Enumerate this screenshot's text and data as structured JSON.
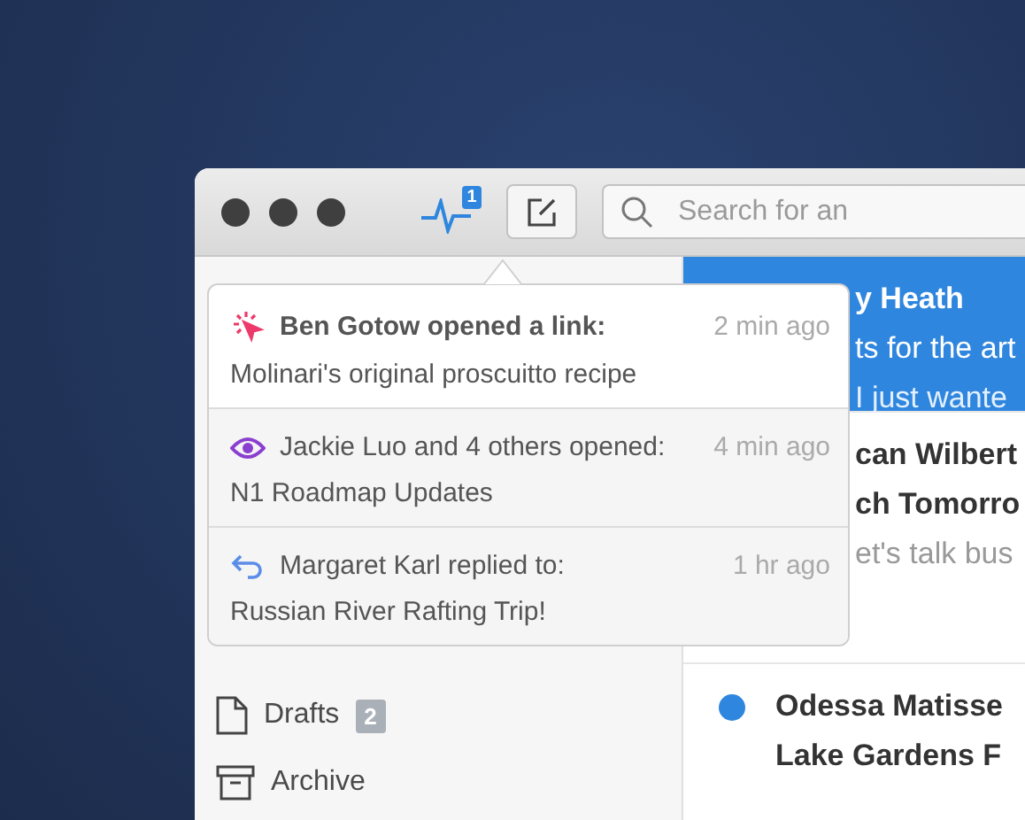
{
  "toolbar": {
    "activity_badge": "1",
    "search": {
      "placeholder": "Search for an"
    }
  },
  "sidebar": {
    "items": [
      {
        "label": "Drafts",
        "count": "2"
      },
      {
        "label": "Archive"
      }
    ]
  },
  "messages": [
    {
      "from": "y Heath",
      "subject": "ts for the art",
      "snippet": "I just wante",
      "selected": true
    },
    {
      "from": "can Wilbert",
      "subject": "ch Tomorro",
      "snippet": "et's talk bus",
      "selected": false
    },
    {
      "from": "Odessa Matisse",
      "subject": "Lake Gardens F",
      "selected": false,
      "unread": true
    }
  ],
  "activity": [
    {
      "kind": "link",
      "title": "Ben Gotow opened a link:",
      "time": "2 min ago",
      "subject": "Molinari's original proscuitto recipe",
      "unread": true
    },
    {
      "kind": "open",
      "title": "Jackie Luo and 4 others opened:",
      "time": "4 min ago",
      "subject": "N1 Roadmap Updates",
      "unread": false
    },
    {
      "kind": "reply",
      "title": "Margaret Karl replied to:",
      "time": "1 hr ago",
      "subject": "Russian River Rafting Trip!",
      "unread": false
    }
  ]
}
